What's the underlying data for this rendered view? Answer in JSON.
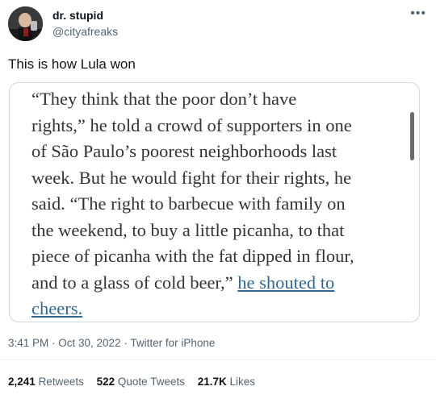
{
  "author": {
    "display_name": "dr. stupid",
    "handle": "@cityafreaks",
    "avatar_icon": "profile-photo"
  },
  "more_icon": "more-options-icon",
  "tweet_text": "This is how Lula won",
  "quote": {
    "lines": [
      "“They think that the poor don’t have",
      "rights,” he told a crowd of supporters in one",
      "of São Paulo’s poorest neighborhoods last",
      "week. But he would fight for their rights, he",
      "said. “The right to barbecue with family on",
      "the weekend, to buy a little picanha, to that",
      "piece of picanha with the fat dipped in flour,"
    ],
    "line8_text": "and to a glass of cold beer,”",
    "link_part1": "he shouted to",
    "link_part2": "cheers.",
    "link_color": "#326891"
  },
  "meta": {
    "timestamp": "3:41 PM · Oct 30, 2022 · Twitter for iPhone"
  },
  "stats": {
    "retweets_count": "2,241",
    "retweets_label": "Retweets",
    "quotes_count": "522",
    "quotes_label": "Quote Tweets",
    "likes_count": "21.7K",
    "likes_label": "Likes"
  }
}
